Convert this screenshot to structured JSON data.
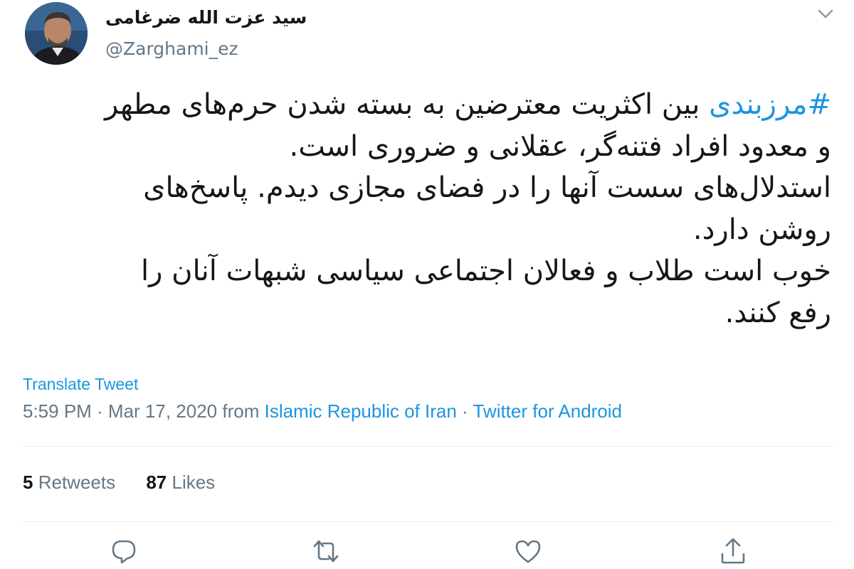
{
  "author": {
    "display_name": "سید عزت الله ضرغامی",
    "handle": "@Zarghami_ez",
    "avatar_icon": "profile-photo"
  },
  "tweet": {
    "hashtag": "#مرزبندی",
    "line1_rest": " بین اکثریت معترضین به بسته شدن حرم‌های مطهر",
    "line2": "و معدود افراد فتنه‌گر، عقلانی و ضروری است.",
    "line3": "استدلال‌های سست آنها را در فضای مجازی دیدم. پاسخ‌های",
    "line4": "روشن دارد.",
    "line5": "خوب است طلاب و فعالان اجتماعی سیاسی شبهات آنان را",
    "line6": "رفع کنند."
  },
  "translate_label": "Translate Tweet",
  "meta": {
    "time_date": "5:59 PM · Mar 17, 2020 from ",
    "location": "Islamic Republic of Iran",
    "separator": " · ",
    "source": "Twitter for Android"
  },
  "stats": {
    "retweets_count": "5",
    "retweets_label": "Retweets",
    "likes_count": "87",
    "likes_label": "Likes"
  },
  "actions": [
    "reply-icon",
    "retweet-icon",
    "like-icon",
    "share-icon"
  ],
  "colors": {
    "link": "#1b95e0",
    "secondary_text": "#657786",
    "primary_text": "#14171a",
    "divider": "#e6ecf0"
  }
}
